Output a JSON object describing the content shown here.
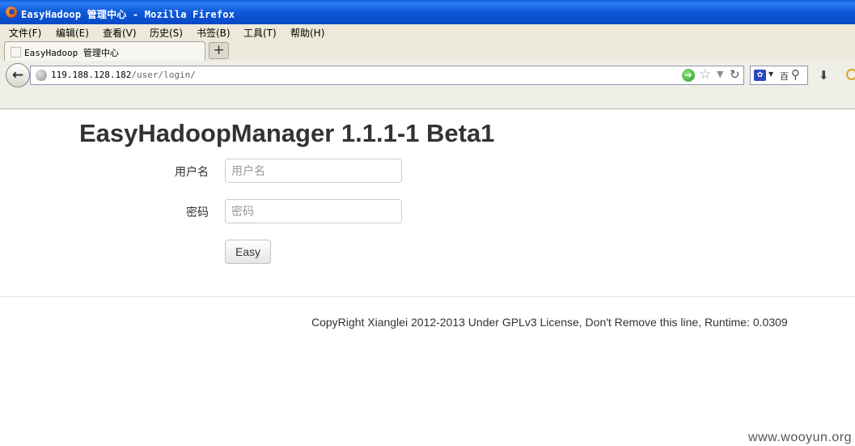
{
  "window": {
    "title": "EasyHadoop 管理中心 - Mozilla Firefox"
  },
  "menubar": {
    "items": [
      "文件(F)",
      "编辑(E)",
      "查看(V)",
      "历史(S)",
      "书签(B)",
      "工具(T)",
      "帮助(H)"
    ]
  },
  "tabs": [
    {
      "label": "EasyHadoop 管理中心"
    }
  ],
  "newtab_label": "+",
  "navbar": {
    "url_host": "119.188.128.182",
    "url_path": "/user/login/",
    "search_engine_text": "百"
  },
  "page": {
    "heading": "EasyHadoopManager 1.1.1-1 Beta1",
    "username_label": "用户名",
    "username_placeholder": "用户名",
    "password_label": "密码",
    "password_placeholder": "密码",
    "submit_label": "Easy",
    "footer": "CopyRight Xianglei 2012-2013 Under GPLv3 License, Don't Remove this line, Runtime: 0.0309",
    "watermark": "www.wooyun.org"
  },
  "icons": {
    "back": "back-arrow-icon",
    "go": "go-arrow-icon",
    "bookmark": "star-icon",
    "reload": "reload-icon",
    "search": "magnifier-icon",
    "downloads": "download-icon"
  },
  "colors": {
    "titlebar": "#0848c4",
    "menubar": "#ece9d8",
    "text": "#333333"
  }
}
